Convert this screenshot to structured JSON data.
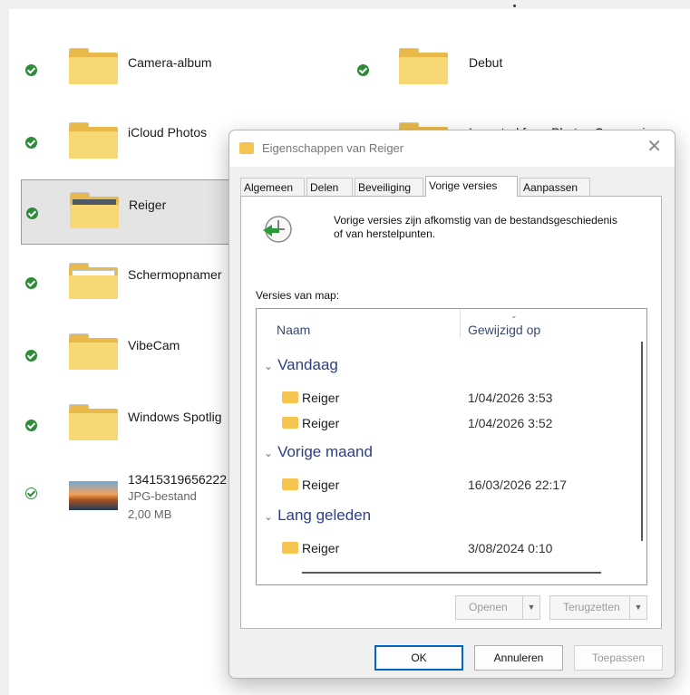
{
  "explorer": {
    "left_items": [
      {
        "name": "Camera-album",
        "type": "folder",
        "status": "synced"
      },
      {
        "name": "iCloud Photos",
        "type": "folder",
        "status": "synced"
      },
      {
        "name": "Reiger",
        "type": "folder-image",
        "status": "synced",
        "selected": true
      },
      {
        "name": "Schermopnamer",
        "type": "folder-screenshot",
        "status": "synced"
      },
      {
        "name": "VibeCam",
        "type": "folder",
        "status": "synced"
      },
      {
        "name": "Windows Spotlig",
        "type": "folder",
        "status": "synced"
      },
      {
        "name": "13415319656222",
        "type": "image",
        "status": "available",
        "subtype": "JPG-bestand",
        "size": "2,00 MB"
      }
    ],
    "right_items": [
      {
        "name": "Debut",
        "type": "folder",
        "status": "synced"
      },
      {
        "name": "Imported from Photos Companion",
        "type": "folder",
        "status": "none"
      }
    ]
  },
  "dialog": {
    "title": "Eigenschappen van Reiger",
    "close_glyph": "✕",
    "tabs": [
      "Algemeen",
      "Delen",
      "Beveiliging",
      "Vorige versies",
      "Aanpassen"
    ],
    "active_tab": "Vorige versies",
    "info_text": "Vorige versies zijn afkomstig van de bestandsgeschiedenis of van herstelpunten.",
    "versions_label": "Versies van map:",
    "columns": {
      "name": "Naam",
      "modified": "Gewijzigd op"
    },
    "groups": [
      {
        "label": "Vandaag",
        "rows": [
          {
            "name": "Reiger",
            "date": "1/04/2026 3:53"
          },
          {
            "name": "Reiger",
            "date": "1/04/2026 3:52"
          }
        ]
      },
      {
        "label": "Vorige maand",
        "rows": [
          {
            "name": "Reiger",
            "date": "16/03/2026 22:17"
          }
        ]
      },
      {
        "label": "Lang geleden",
        "rows": [
          {
            "name": "Reiger",
            "date": "3/08/2024 0:10"
          }
        ]
      }
    ],
    "buttons": {
      "open": "Openen",
      "restore": "Terugzetten",
      "ok": "OK",
      "cancel": "Annuleren",
      "apply": "Toepassen"
    },
    "icons": {
      "dialog": "clock-history-icon",
      "chevron": "chevron-down-icon",
      "close": "close-icon"
    }
  },
  "colors": {
    "sync_green": "#2e8b3a",
    "group_blue": "#2c3e8a",
    "primary_border": "#0067c0",
    "folder": "#f8d775"
  }
}
